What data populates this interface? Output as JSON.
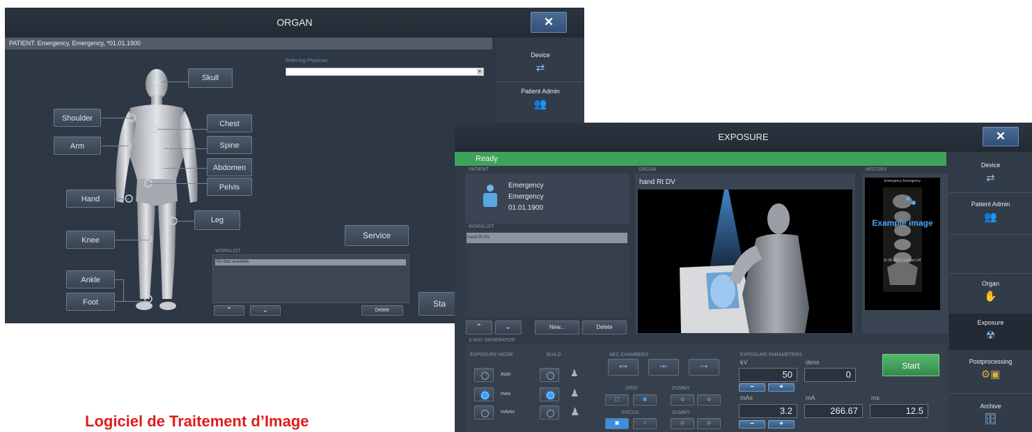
{
  "organ_window": {
    "title": "ORGAN",
    "close_label": "✕",
    "patient_line": "PATIENT: Emergency, Emergency, *01.01.1900",
    "referring_label": "Referring Physician",
    "referring_value": "",
    "body_buttons": {
      "skull": "Skull",
      "shoulder": "Shoulder",
      "arm": "Arm",
      "chest": "Chest",
      "spine": "Spine",
      "abdomen": "Abdomen",
      "pelvis": "Pelvis",
      "hand": "Hand",
      "leg": "Leg",
      "knee": "Knee",
      "ankle": "Ankle",
      "foot": "Foot"
    },
    "service_label": "Service",
    "start_label": "Sta",
    "worklist_label": "WORKLIST",
    "worklist_items": [
      "No data available"
    ],
    "delete_label": "Delete",
    "side": {
      "device": "Device",
      "patient_admin": "Patient Admin"
    }
  },
  "exposure_window": {
    "title": "EXPOSURE",
    "close_label": "✕",
    "status": "Ready",
    "patient_label": "PATIENT",
    "patient_lines": [
      "Emergency",
      "Emergency",
      "01.01.1900"
    ],
    "organ_label": "ORGAN",
    "organ_value": "hand Rt DV",
    "history_label": "HISTORY",
    "history_caption_top": "Emergency Emergency",
    "history_overlay": "Example image",
    "history_caption_bottom": "11.09.2012 | Li Foot LAT",
    "worklist_label": "WORKLIST",
    "worklist_items": [
      "hand Rt DV"
    ],
    "new_label": "New...",
    "delete_label": "Delete",
    "xray_generator_label": "X-RAY GENERATOR",
    "exposure_mode_label": "EXPOSURE MODE",
    "modes": [
      "Auto",
      "mAs",
      "mAms"
    ],
    "build_label": "BUILD",
    "aec_label": "AEC CHAMBERS",
    "grid_label": "GRID",
    "dummy_label": "DUMMY",
    "focus_label": "FOCUS",
    "params_label": "EXPOSURE PARAMETERS",
    "kv_label": "kV",
    "kv_value": "50",
    "dens_label": "dens",
    "dens_value": "0",
    "mas_label": "mAs",
    "mas_value": "3.2",
    "ma_label": "mA",
    "ma_value": "266.67",
    "ms_label": "ms",
    "ms_value": "12.5",
    "minus": "−",
    "plus": "+",
    "start_label": "Start",
    "side": {
      "device": "Device",
      "patient_admin": "Patient Admin",
      "organ": "Organ",
      "exposure": "Exposure",
      "postprocessing": "Postprocessing",
      "archive": "Archive"
    }
  },
  "caption": "Logiciel de Traitement d’Image"
}
